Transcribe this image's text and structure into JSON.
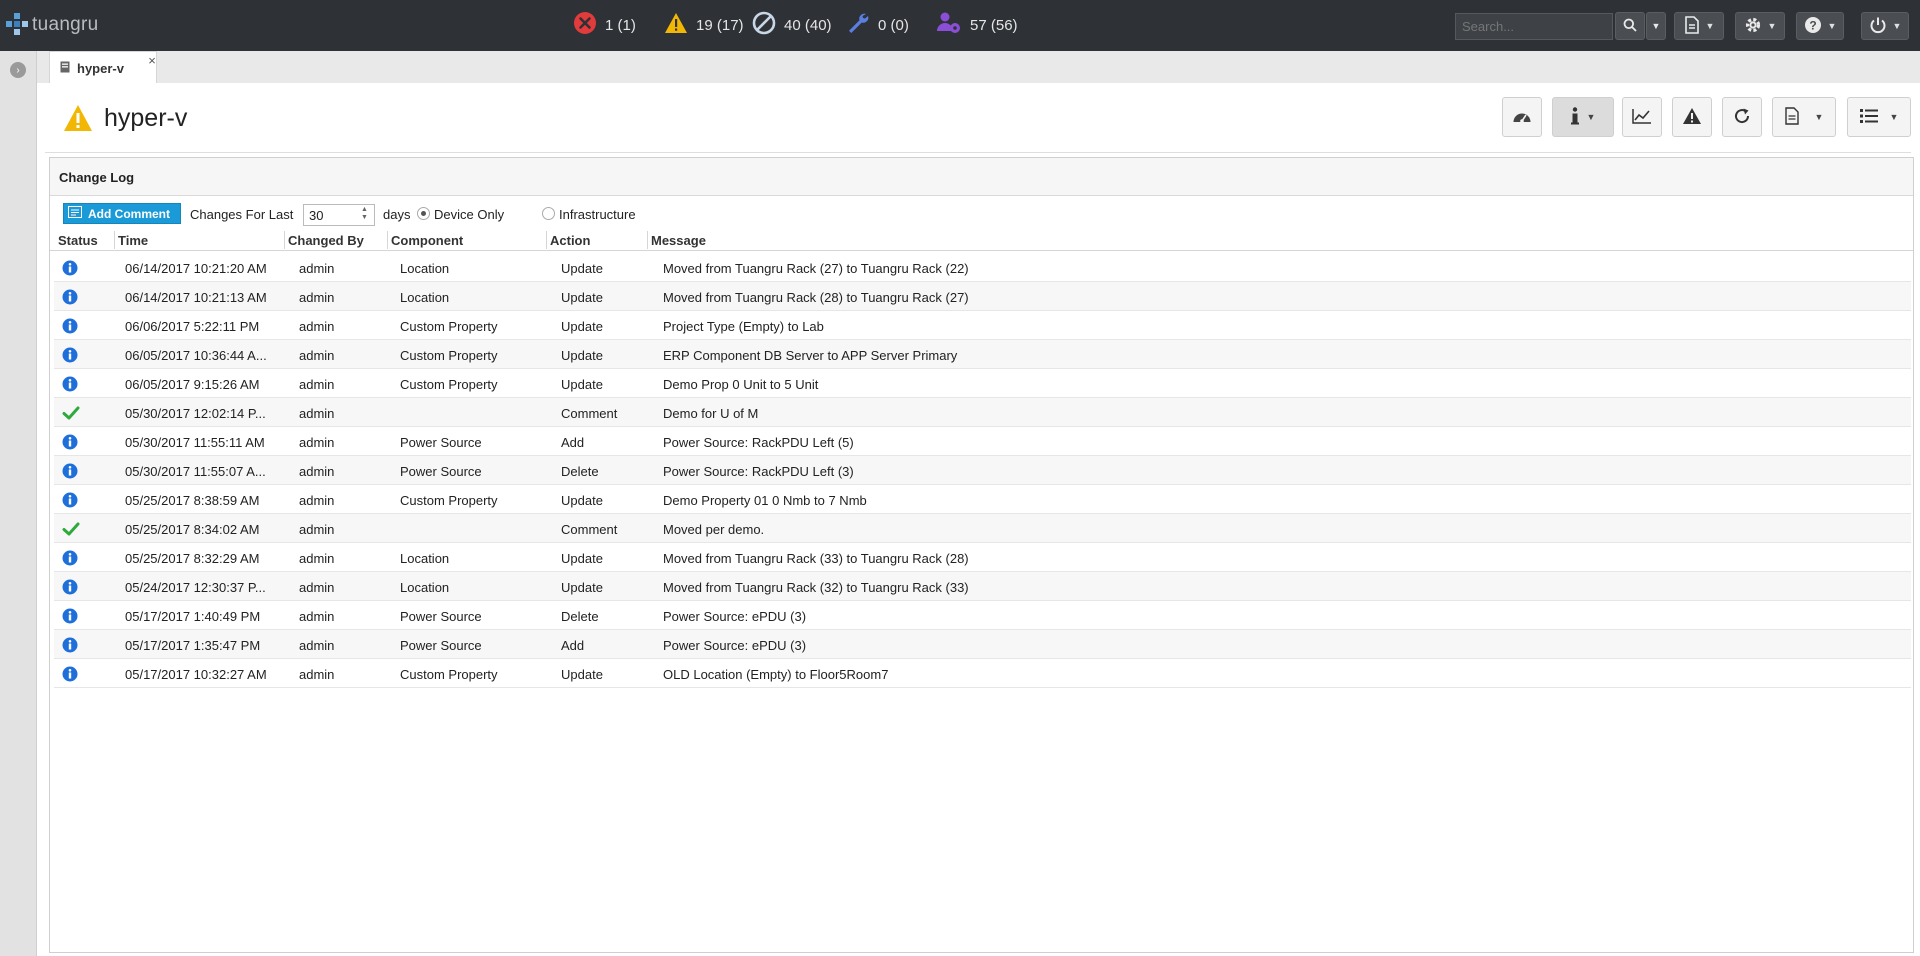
{
  "app": {
    "logo_text": "tuangru",
    "tab_title": "hyper-v",
    "close_glyph": "×"
  },
  "stats": {
    "critical": "1 (1)",
    "warning": "19 (17)",
    "disabled": "40 (40)",
    "maintenance": "0 (0)",
    "users": "57 (56)"
  },
  "search": {
    "placeholder": "Search..."
  },
  "page": {
    "title": "hyper-v",
    "status": "warning"
  },
  "panel": {
    "title": "Change Log",
    "add_comment_label": "Add Comment",
    "changes_for_last_label": "Changes For Last",
    "days_value": "30",
    "days_label": "days",
    "device_only_label": "Device Only",
    "infrastructure_label": "Infrastructure",
    "selected_scope": "Device Only"
  },
  "columns": {
    "status": "Status",
    "time": "Time",
    "changed_by": "Changed By",
    "component": "Component",
    "action": "Action",
    "message": "Message"
  },
  "rows": [
    {
      "status": "info",
      "time": "06/14/2017 10:21:20 AM",
      "changed_by": "admin",
      "component": "Location",
      "action": "Update",
      "message": "Moved from Tuangru Rack (27) to Tuangru Rack (22)"
    },
    {
      "status": "info",
      "time": "06/14/2017 10:21:13 AM",
      "changed_by": "admin",
      "component": "Location",
      "action": "Update",
      "message": "Moved from Tuangru Rack (28) to Tuangru Rack (27)"
    },
    {
      "status": "info",
      "time": "06/06/2017 5:22:11 PM",
      "changed_by": "admin",
      "component": "Custom Property",
      "action": "Update",
      "message": "Project Type (Empty) to Lab"
    },
    {
      "status": "info",
      "time": "06/05/2017 10:36:44 A...",
      "changed_by": "admin",
      "component": "Custom Property",
      "action": "Update",
      "message": "ERP Component DB Server to APP Server Primary"
    },
    {
      "status": "info",
      "time": "06/05/2017 9:15:26 AM",
      "changed_by": "admin",
      "component": "Custom Property",
      "action": "Update",
      "message": "Demo Prop 0 Unit to 5 Unit"
    },
    {
      "status": "comment",
      "time": "05/30/2017 12:02:14 P...",
      "changed_by": "admin",
      "component": "",
      "action": "Comment",
      "message": "Demo for U of M"
    },
    {
      "status": "info",
      "time": "05/30/2017 11:55:11 AM",
      "changed_by": "admin",
      "component": "Power Source",
      "action": "Add",
      "message": "Power Source: RackPDU Left (5)"
    },
    {
      "status": "info",
      "time": "05/30/2017 11:55:07 A...",
      "changed_by": "admin",
      "component": "Power Source",
      "action": "Delete",
      "message": "Power Source: RackPDU Left (3)"
    },
    {
      "status": "info",
      "time": "05/25/2017 8:38:59 AM",
      "changed_by": "admin",
      "component": "Custom Property",
      "action": "Update",
      "message": "Demo Property 01 0 Nmb to 7 Nmb"
    },
    {
      "status": "comment",
      "time": "05/25/2017 8:34:02 AM",
      "changed_by": "admin",
      "component": "",
      "action": "Comment",
      "message": "Moved per demo."
    },
    {
      "status": "info",
      "time": "05/25/2017 8:32:29 AM",
      "changed_by": "admin",
      "component": "Location",
      "action": "Update",
      "message": "Moved from Tuangru Rack (33) to Tuangru Rack (28)"
    },
    {
      "status": "info",
      "time": "05/24/2017 12:30:37 P...",
      "changed_by": "admin",
      "component": "Location",
      "action": "Update",
      "message": "Moved from Tuangru Rack (32) to Tuangru Rack (33)"
    },
    {
      "status": "info",
      "time": "05/17/2017 1:40:49 PM",
      "changed_by": "admin",
      "component": "Power Source",
      "action": "Delete",
      "message": "Power Source: ePDU (3)"
    },
    {
      "status": "info",
      "time": "05/17/2017 1:35:47 PM",
      "changed_by": "admin",
      "component": "Power Source",
      "action": "Add",
      "message": "Power Source: ePDU (3)"
    },
    {
      "status": "info",
      "time": "05/17/2017 10:32:27 AM",
      "changed_by": "admin",
      "component": "Custom Property",
      "action": "Update",
      "message": "OLD Location (Empty) to Floor5Room7"
    }
  ],
  "colors": {
    "topbar": "#2e3135",
    "critical": "#e23b3b",
    "warning": "#f2b705",
    "info": "#1e6fd9",
    "comment_check": "#2eaa3c",
    "accent_button": "#1a9ad6",
    "users_icon": "#8a4fd6",
    "maintenance_icon": "#5b7fe0"
  }
}
